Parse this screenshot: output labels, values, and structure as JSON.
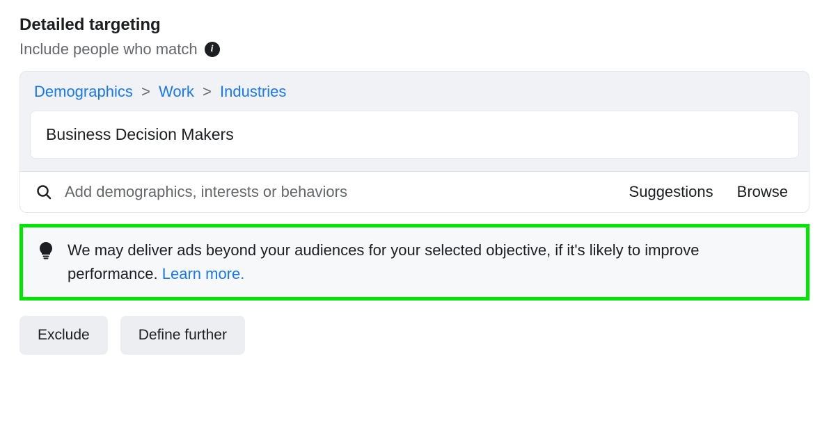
{
  "header": {
    "title": "Detailed targeting",
    "subtitle": "Include people who match"
  },
  "breadcrumb": {
    "level1": "Demographics",
    "level2": "Work",
    "level3": "Industries",
    "separator": ">"
  },
  "selection": {
    "item": "Business Decision Makers"
  },
  "search": {
    "placeholder": "Add demographics, interests or behaviors",
    "value": "",
    "suggestions_label": "Suggestions",
    "browse_label": "Browse"
  },
  "notice": {
    "text": "We may deliver ads beyond your audiences for your selected objective, if it's likely to improve performance. ",
    "learn_more": "Learn more."
  },
  "buttons": {
    "exclude": "Exclude",
    "define_further": "Define further"
  }
}
